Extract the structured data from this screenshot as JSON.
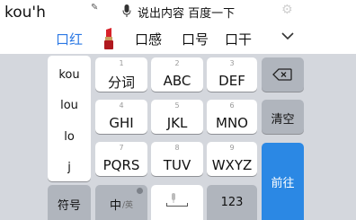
{
  "topbar": {
    "composing_text": "kou'h",
    "voice_hint": "说出内容 百度一下"
  },
  "candidates": {
    "items": [
      "口红",
      "口感",
      "口号",
      "口干"
    ],
    "emoji": "lipstick"
  },
  "pinyin": [
    "kou",
    "lou",
    "lo",
    "j"
  ],
  "keys": {
    "row1": [
      {
        "num": "1",
        "label": "分词"
      },
      {
        "num": "2",
        "label": "ABC"
      },
      {
        "num": "3",
        "label": "DEF"
      }
    ],
    "row2": [
      {
        "num": "4",
        "label": "GHI"
      },
      {
        "num": "5",
        "label": "JKL"
      },
      {
        "num": "6",
        "label": "MNO"
      }
    ],
    "row3": [
      {
        "num": "7",
        "label": "PQRS"
      },
      {
        "num": "8",
        "label": "TUV"
      },
      {
        "num": "9",
        "label": "WXYZ"
      }
    ],
    "clear": "清空",
    "enter": "前往",
    "symbol": "符号",
    "lang": "中",
    "lang_sub": "/英",
    "number": "123"
  },
  "colors": {
    "accent": "#2b78e4",
    "enter": "#2b88e4",
    "keyboard_bg": "#d4d7dd",
    "dark_key": "#b0b5bd"
  }
}
